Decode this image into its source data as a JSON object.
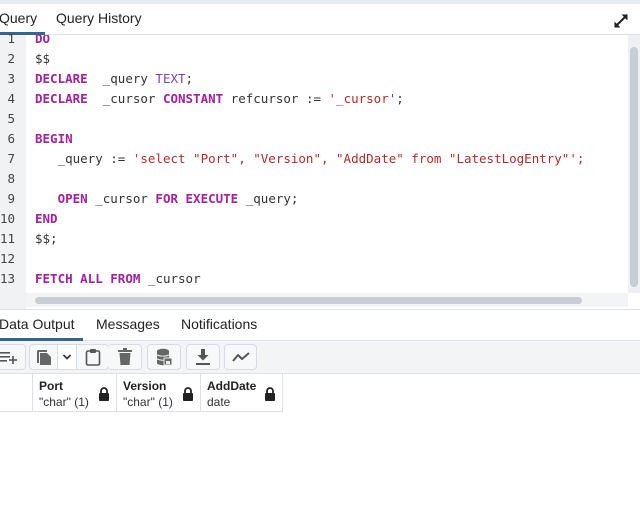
{
  "query_tabs": [
    {
      "label": "Query",
      "active": true
    },
    {
      "label": "Query History",
      "active": false
    }
  ],
  "expand_icon": "expand-arrows-icon",
  "editor": {
    "line_numbers": [
      "1",
      "2",
      "3",
      "4",
      "5",
      "6",
      "7",
      "8",
      "9",
      "10",
      "11",
      "12",
      "13"
    ],
    "lines": [
      [
        {
          "t": "DO",
          "c": "kw"
        }
      ],
      [
        {
          "t": "$$",
          "c": ""
        }
      ],
      [
        {
          "t": "DECLARE",
          "c": "kw"
        },
        {
          "t": "  _query ",
          "c": ""
        },
        {
          "t": "TEXT",
          "c": "ty"
        },
        {
          "t": ";",
          "c": ""
        }
      ],
      [
        {
          "t": "DECLARE",
          "c": "kw"
        },
        {
          "t": "  _cursor ",
          "c": ""
        },
        {
          "t": "CONSTANT",
          "c": "kw"
        },
        {
          "t": " refcursor := ",
          "c": ""
        },
        {
          "t": "'_cursor'",
          "c": "str"
        },
        {
          "t": ";",
          "c": ""
        }
      ],
      [],
      [
        {
          "t": "BEGIN",
          "c": "kw"
        }
      ],
      [
        {
          "t": "   _query := ",
          "c": ""
        },
        {
          "t": "'select \"Port\", \"Version\", \"AddDate\" from \"LatestLogEntry\"';",
          "c": "str"
        }
      ],
      [],
      [
        {
          "t": "   ",
          "c": ""
        },
        {
          "t": "OPEN",
          "c": "kw"
        },
        {
          "t": " _cursor ",
          "c": ""
        },
        {
          "t": "FOR",
          "c": "kw"
        },
        {
          "t": " ",
          "c": ""
        },
        {
          "t": "EXECUTE",
          "c": "kw"
        },
        {
          "t": " _query;",
          "c": ""
        }
      ],
      [
        {
          "t": "END",
          "c": "kw"
        }
      ],
      [
        {
          "t": "$$;",
          "c": ""
        }
      ],
      [],
      [
        {
          "t": "FETCH",
          "c": "kw"
        },
        {
          "t": " ",
          "c": ""
        },
        {
          "t": "ALL",
          "c": "kw"
        },
        {
          "t": " ",
          "c": ""
        },
        {
          "t": "FROM",
          "c": "kw"
        },
        {
          "t": " _cursor",
          "c": ""
        }
      ]
    ]
  },
  "output_tabs": [
    {
      "label": "Data Output",
      "active": true
    },
    {
      "label": "Messages",
      "active": false
    },
    {
      "label": "Notifications",
      "active": false
    }
  ],
  "toolbar": {
    "buttons": [
      {
        "name": "add-row-button",
        "icon": "add-row-icon"
      },
      {
        "name": "copy-button",
        "icon": "copy-icon"
      },
      {
        "name": "copy-options-dropdown",
        "icon": "chevron-down-icon"
      },
      {
        "name": "paste-button",
        "icon": "clipboard-icon"
      },
      {
        "name": "delete-button",
        "icon": "trash-icon"
      },
      {
        "name": "save-data-button",
        "icon": "database-save-icon"
      },
      {
        "name": "download-button",
        "icon": "download-icon"
      },
      {
        "name": "graph-visualiser-button",
        "icon": "line-chart-icon"
      }
    ]
  },
  "grid": {
    "columns": [
      {
        "name": "Port",
        "type": "\"char\" (1)",
        "locked": true
      },
      {
        "name": "Version",
        "type": "\"char\" (1)",
        "locked": true
      },
      {
        "name": "AddDate",
        "type": "date",
        "locked": true
      }
    ],
    "rows": []
  },
  "colors": {
    "accent": "#326690",
    "keyword": "#a2219e",
    "type": "#7a44b5",
    "string": "#b52a2a"
  }
}
